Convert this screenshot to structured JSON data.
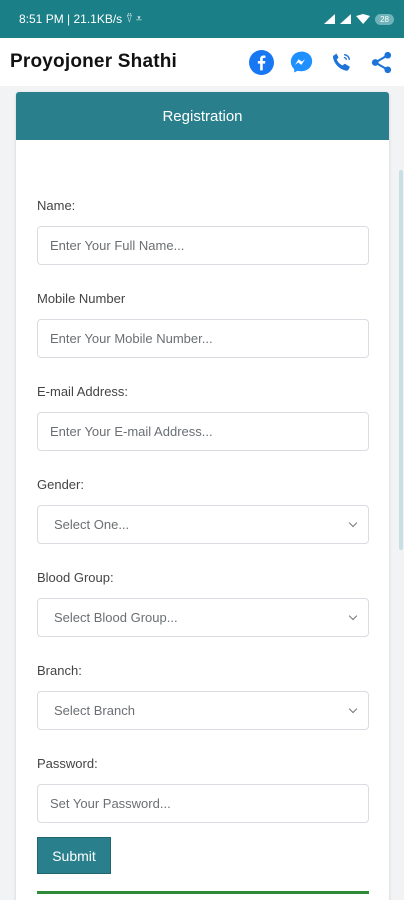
{
  "status_bar": {
    "time_info": "8:51 PM | 21.1KB/s",
    "extra_icons": "⍢ ⩡",
    "battery": "28"
  },
  "app_bar": {
    "title": "Proyojoner Shathi",
    "icons": [
      "facebook-icon",
      "messenger-icon",
      "phone-icon",
      "share-icon"
    ]
  },
  "form": {
    "header": "Registration",
    "name_label": "Name:",
    "name_placeholder": "Enter Your Full Name...",
    "mobile_label": "Mobile Number",
    "mobile_placeholder": "Enter Your Mobile Number...",
    "email_label": "E-mail Address:",
    "email_placeholder": "Enter Your E-mail Address...",
    "gender_label": "Gender:",
    "gender_value": "Select One...",
    "blood_label": "Blood Group:",
    "blood_value": "Select Blood Group...",
    "branch_label": "Branch:",
    "branch_value": "Select Branch",
    "password_label": "Password:",
    "password_placeholder": "Set Your Password...",
    "submit_label": "Submit"
  },
  "colors": {
    "status_bar": "#1b7f87",
    "header": "#2a7f8c",
    "accent_line": "#2e8b3a"
  }
}
